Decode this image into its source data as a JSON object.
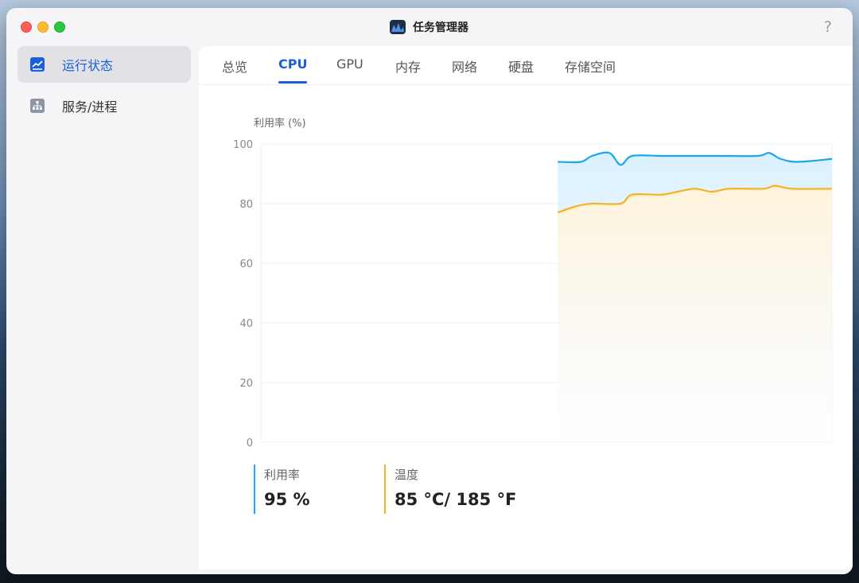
{
  "window": {
    "title": "任务管理器",
    "help": "?"
  },
  "sidebar": {
    "items": [
      {
        "label": "运行状态",
        "icon": "chart-icon",
        "active": true
      },
      {
        "label": "服务/进程",
        "icon": "hierarchy-icon",
        "active": false
      }
    ]
  },
  "tabs": [
    {
      "label": "总览"
    },
    {
      "label": "CPU",
      "active": true
    },
    {
      "label": "GPU"
    },
    {
      "label": "内存"
    },
    {
      "label": "网络"
    },
    {
      "label": "硬盘"
    },
    {
      "label": "存储空间"
    }
  ],
  "chart_data": {
    "type": "area",
    "title": "",
    "ylabel": "利用率 (%)",
    "ylim": [
      0,
      100
    ],
    "yticks": [
      0,
      20,
      40,
      60,
      80,
      100
    ],
    "grid": true,
    "series": [
      {
        "name": "利用率",
        "color": "#1aa7ec",
        "points": [
          [
            0.52,
            94
          ],
          [
            0.56,
            94
          ],
          [
            0.58,
            96
          ],
          [
            0.61,
            97
          ],
          [
            0.63,
            93
          ],
          [
            0.65,
            96
          ],
          [
            0.7,
            96
          ],
          [
            0.75,
            96
          ],
          [
            0.8,
            96
          ],
          [
            0.87,
            96
          ],
          [
            0.89,
            97
          ],
          [
            0.91,
            95
          ],
          [
            0.94,
            94
          ],
          [
            1.0,
            95
          ]
        ]
      },
      {
        "name": "温度",
        "color": "#f6b320",
        "points": [
          [
            0.52,
            77
          ],
          [
            0.55,
            79
          ],
          [
            0.58,
            80
          ],
          [
            0.63,
            80
          ],
          [
            0.65,
            83
          ],
          [
            0.7,
            83
          ],
          [
            0.73,
            84
          ],
          [
            0.76,
            85
          ],
          [
            0.79,
            84
          ],
          [
            0.82,
            85
          ],
          [
            0.88,
            85
          ],
          [
            0.9,
            86
          ],
          [
            0.93,
            85
          ],
          [
            1.0,
            85
          ]
        ]
      }
    ]
  },
  "metrics": [
    {
      "label": "利用率",
      "value": "95 %",
      "color": "#1aa7ec"
    },
    {
      "label": "温度",
      "value": "85 °C/ 185 °F",
      "color": "#f6b320"
    }
  ]
}
